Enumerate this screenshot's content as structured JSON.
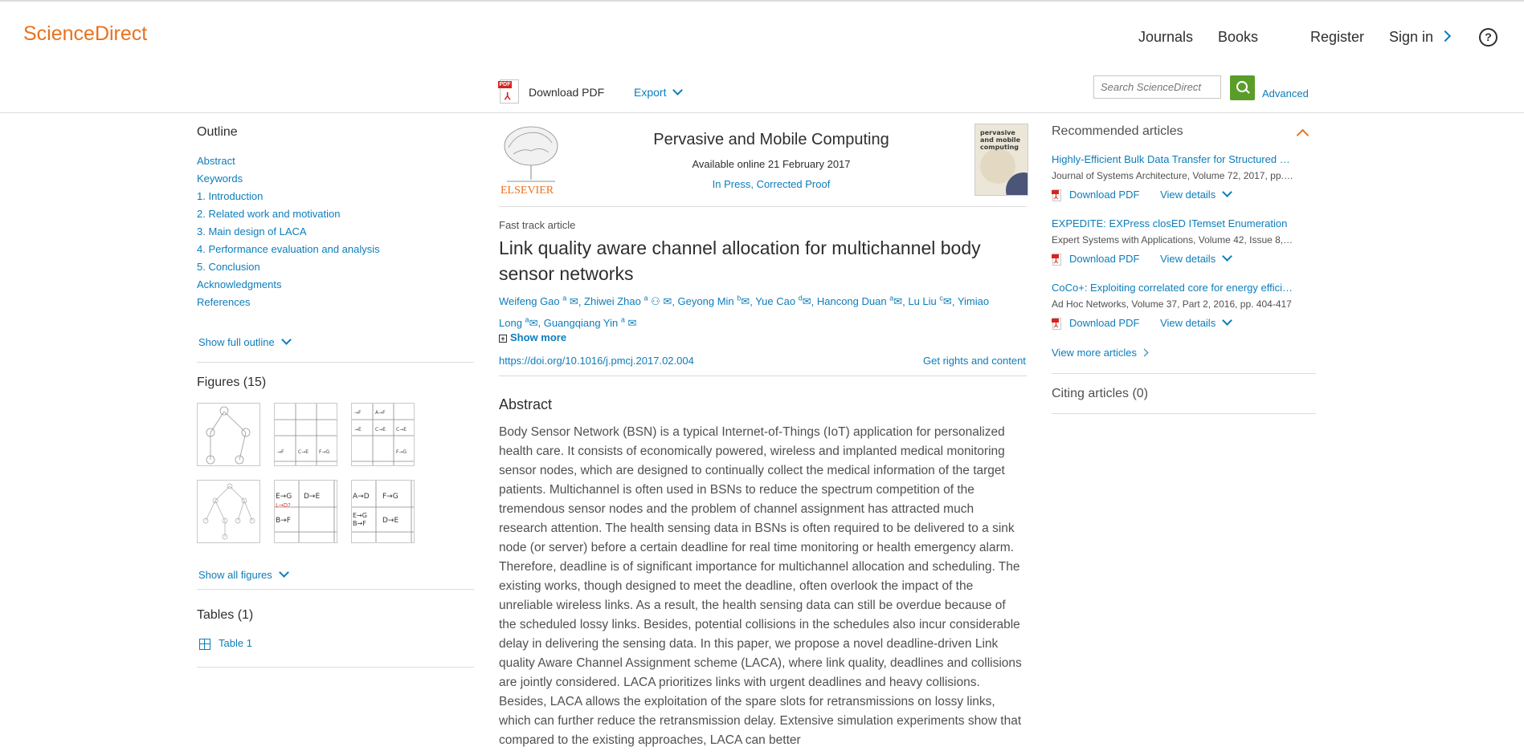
{
  "header": {
    "logo": "ScienceDirect",
    "nav": [
      "Journals",
      "Books",
      "Register",
      "Sign in"
    ],
    "help_glyph": "?"
  },
  "toolbar": {
    "download_pdf": "Download PDF",
    "export": "Export",
    "search_placeholder": "Search ScienceDirect",
    "advanced": "Advanced"
  },
  "outline": {
    "title": "Outline",
    "items": [
      "Abstract",
      "Keywords",
      "1. Introduction",
      "2. Related work and motivation",
      "3. Main design of LACA",
      "4. Performance evaluation and analysis",
      "5. Conclusion",
      "Acknowledgments",
      "References"
    ],
    "show_full": "Show full outline"
  },
  "figures": {
    "title": "Figures (15)",
    "show_all": "Show all figures"
  },
  "tables": {
    "title": "Tables (1)",
    "items": [
      "Table 1"
    ]
  },
  "journal": {
    "name": "Pervasive and Mobile Computing",
    "available": "Available online 21 February 2017",
    "status": "In Press, Corrected Proof",
    "publisher": "ELSEVIER",
    "cover_text": "pervasive and mobile computing"
  },
  "article": {
    "type": "Fast track article",
    "title": "Link quality aware channel allocation for multichannel body sensor networks",
    "authors": [
      {
        "name": "Weifeng Gao",
        "aff": "a"
      },
      {
        "name": "Zhiwei Zhao",
        "aff": "a"
      },
      {
        "name": "Geyong Min",
        "aff": "b"
      },
      {
        "name": "Yue Cao",
        "aff": "d"
      },
      {
        "name": "Hancong Duan",
        "aff": "a"
      },
      {
        "name": "Lu Liu",
        "aff": "c"
      },
      {
        "name": "Yimiao Long",
        "aff": "a"
      },
      {
        "name": "Guangqiang Yin",
        "aff": "a"
      }
    ],
    "show_more": "Show more",
    "doi": "https://doi.org/10.1016/j.pmcj.2017.02.004",
    "rights": "Get rights and content",
    "abstract_heading": "Abstract",
    "abstract_text": "Body Sensor Network (BSN) is a typical Internet-of-Things (IoT) application for personalized health care. It consists of economically powered, wireless and implanted medical monitoring sensor nodes, which are designed to continually collect the medical information of the target patients. Multichannel is often used in BSNs to reduce the spectrum competition of the tremendous sensor nodes and the problem of channel assignment has attracted much research attention. The health sensing data in BSNs is often required to be delivered to a sink node (or server) before a certain deadline for real time monitoring or health emergency alarm. Therefore, deadline is of significant importance for multichannel allocation and scheduling. The existing works, though designed to meet the deadline, often overlook the impact of the unreliable wireless links. As a result, the health sensing data can still be overdue because of the scheduled lossy links. Besides, potential collisions in the schedules also incur considerable delay in delivering the sensing data. In this paper, we propose a novel deadline-driven Link quality Aware Channel Assignment scheme (LACA), where link quality, deadlines and collisions are jointly considered. LACA prioritizes links with urgent deadlines and heavy collisions. Besides, LACA allows the exploitation of the spare slots for retransmissions on lossy links, which can further reduce the retransmission delay. Extensive simulation experiments show that compared to the existing approaches, LACA can better"
  },
  "recommended": {
    "title": "Recommended articles",
    "items": [
      {
        "title": "Highly-Efficient Bulk Data Transfer for Structured …",
        "source": "Journal of Systems Architecture, Volume 72, 2017, pp.…"
      },
      {
        "title": "EXPEDITE: EXPress closED ITemset Enumeration",
        "source": "Expert Systems with Applications, Volume 42, Issue 8,…"
      },
      {
        "title": "CoCo+: Exploiting correlated core for energy effici…",
        "source": "Ad Hoc Networks, Volume 37, Part 2, 2016, pp. 404-417"
      }
    ],
    "download_pdf": "Download PDF",
    "view_details": "View details",
    "view_more": "View more articles"
  },
  "citing": {
    "title": "Citing articles (0)"
  },
  "colors": {
    "brand_orange": "#e9711c",
    "link_blue": "#0c7dbb",
    "search_green": "#5a9e29",
    "pdf_red": "#d6251c"
  }
}
